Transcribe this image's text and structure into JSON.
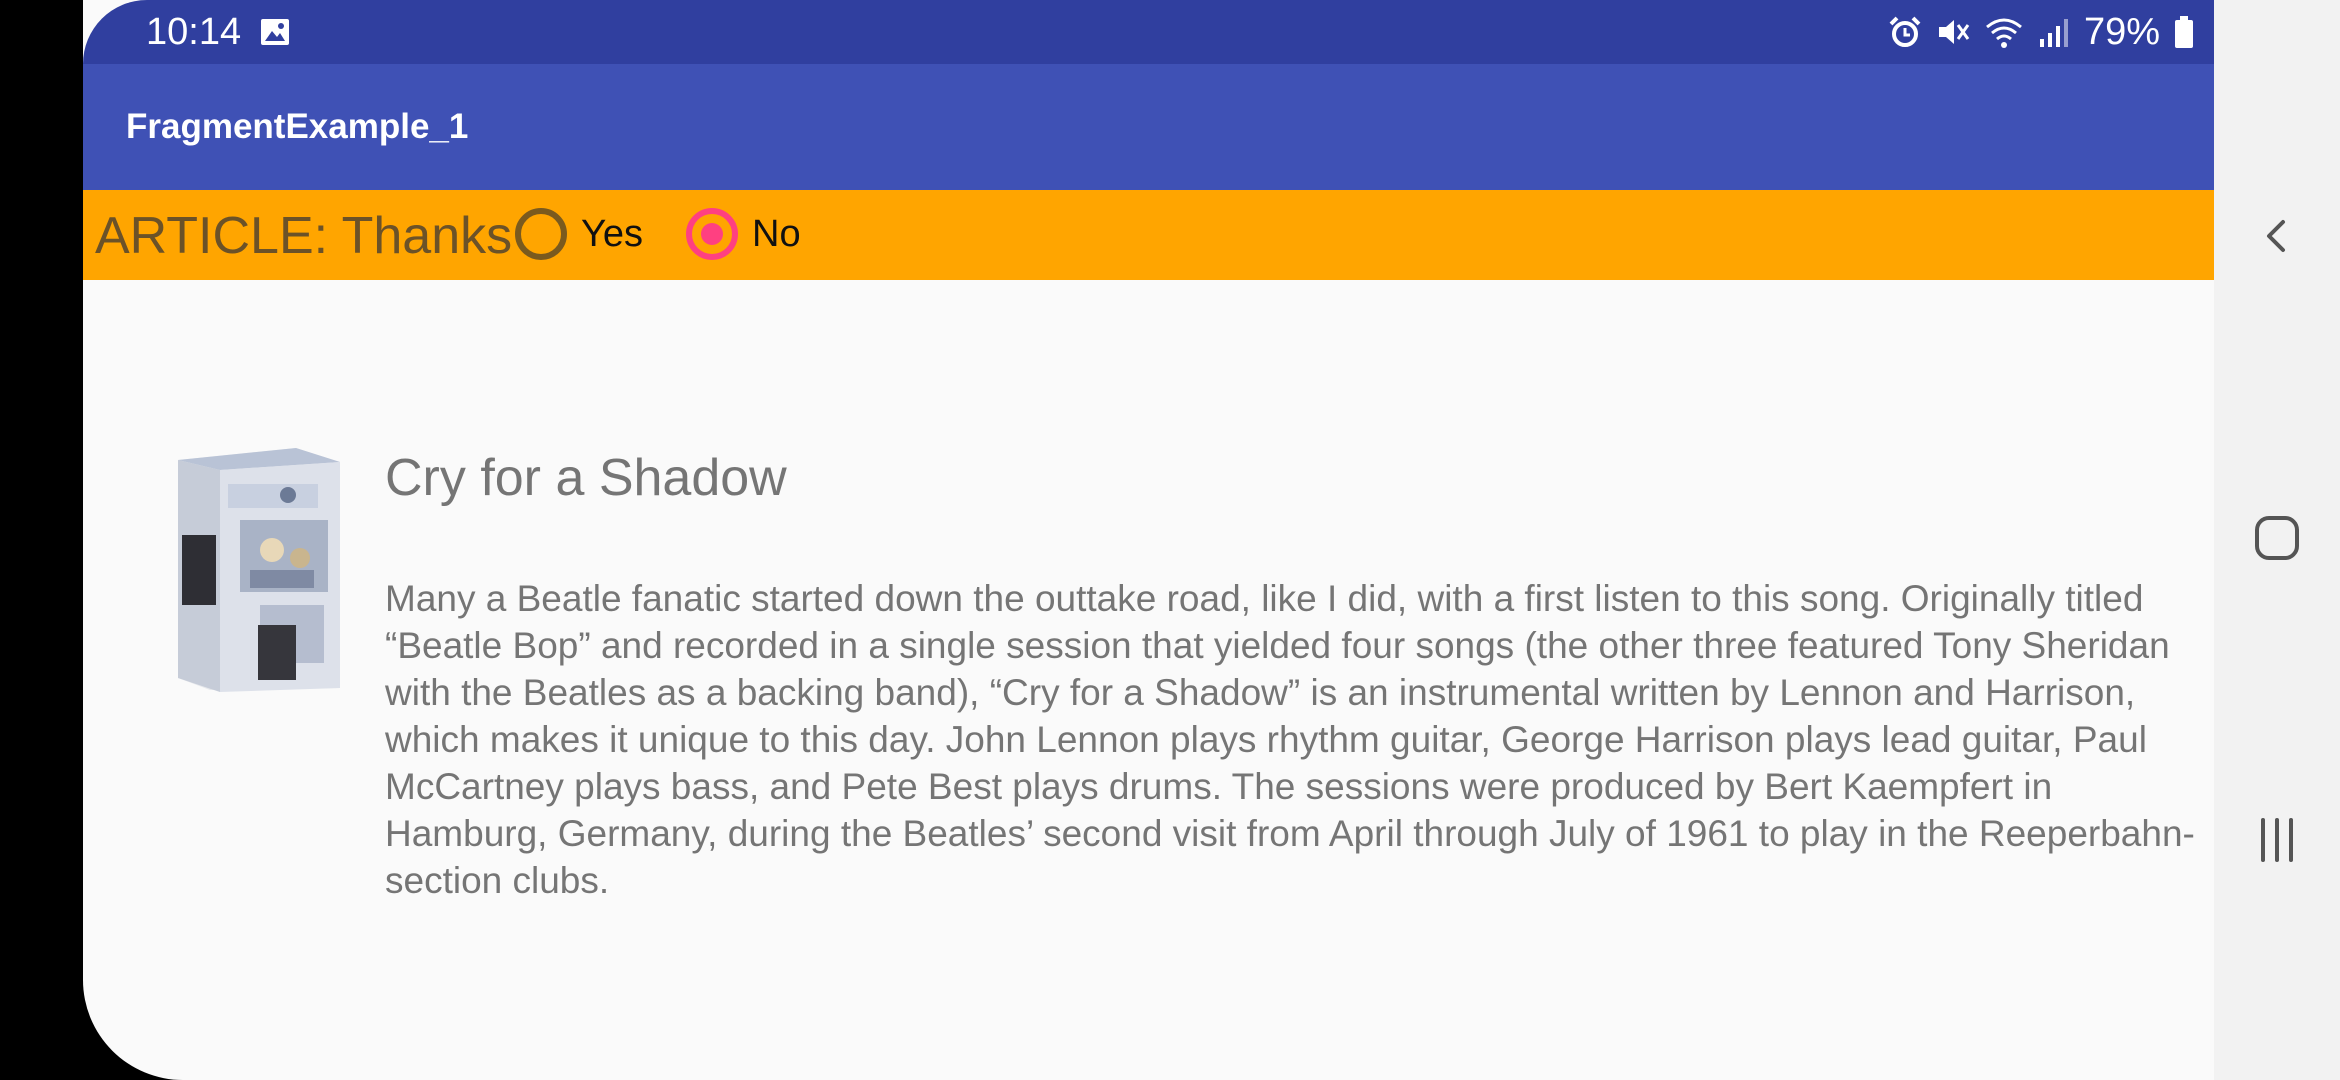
{
  "status_bar": {
    "time": "10:14",
    "battery": "79%",
    "icons": [
      "gallery-icon",
      "alarm-icon",
      "mute-icon",
      "wifi-icon",
      "signal-icon",
      "battery-icon"
    ]
  },
  "app_bar": {
    "title": "FragmentExample_1",
    "color": "#3f51b5",
    "status_color": "#303f9f"
  },
  "article_bar": {
    "label": "ARTICLE: Thanks",
    "color": "#ffa500",
    "options": [
      {
        "label": "Yes",
        "checked": false
      },
      {
        "label": "No",
        "checked": true
      }
    ],
    "accent": "#ff4081"
  },
  "article": {
    "image": "album-cover",
    "title": "Cry for a Shadow",
    "body": "Many a Beatle fanatic started down the outtake road, like I did, with a first listen to this song. Originally titled “Beatle Bop” and recorded in a single session that yielded four songs (the other three featured Tony Sheridan with the Beatles as a backing band), “Cry for a Shadow” is an instrumental written by Lennon and Harrison, which makes it unique to this day. John Lennon plays rhythm guitar, George Harrison plays lead guitar, Paul McCartney plays bass, and Pete Best plays drums. The sessions were produced by Bert Kaempfert in Hamburg, Germany, during the Beatles’ second visit from April through July of 1961 to play in the Reeperbahn-section clubs."
  },
  "nav_bar": {
    "buttons": [
      "back-icon",
      "home-icon",
      "recents-icon"
    ]
  }
}
